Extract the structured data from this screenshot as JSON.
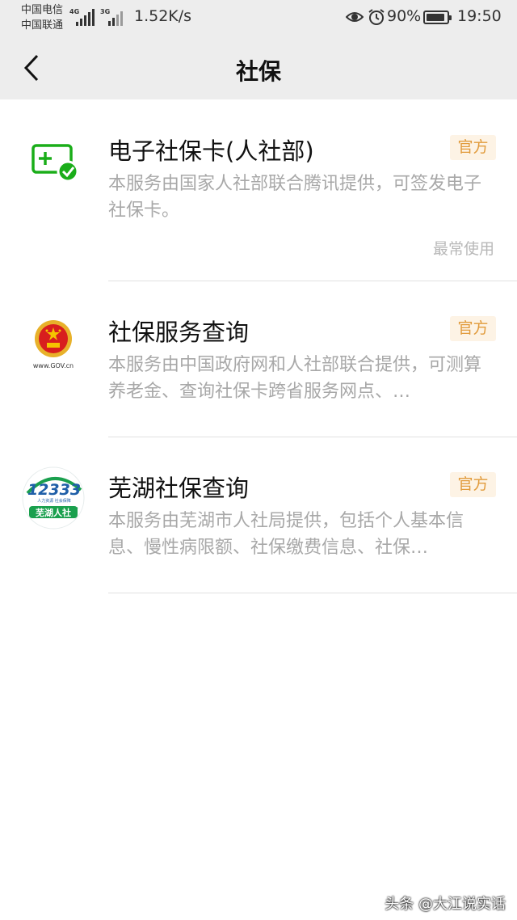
{
  "status_bar": {
    "carrier_1": "中国电信",
    "carrier_2": "中国联通",
    "net_1": "4G",
    "net_2": "3G",
    "net_speed": "1.52K/s",
    "battery": "90%",
    "battery_level": 0.9,
    "time": "19:50",
    "icons": [
      "eye-icon",
      "alarm-icon",
      "battery-icon",
      "signal-icon"
    ]
  },
  "nav": {
    "back_icon": "chevron-left-icon",
    "title": "社保"
  },
  "services": [
    {
      "name": "电子社保卡(人社部)",
      "badge": "官方",
      "description": "本服务由国家人社部联合腾讯提供，可签发电子社保卡。",
      "usage_label": "最常使用",
      "icon": "e-social-security-card-icon",
      "accent": "#1aad19"
    },
    {
      "name": "社保服务查询",
      "badge": "官方",
      "description": "本服务由中国政府网和人社部联合提供，可测算养老金、查询社保卡跨省服务网点、…",
      "logo_caption": "www.GOV.cn",
      "icon": "national-emblem-icon"
    },
    {
      "name": "芜湖社保查询",
      "badge": "官方",
      "description": "本服务由芜湖市人社局提供，包括个人基本信息、慢性病限额、社保缴费信息、社保…",
      "logo_number": "12333",
      "logo_sub": "人力资源 社会保障",
      "logo_caption": "芜湖人社",
      "icon": "wuhu-hrss-logo-icon"
    }
  ],
  "badge_color": "#e19b3c",
  "watermark": "头条 @大江说实话"
}
